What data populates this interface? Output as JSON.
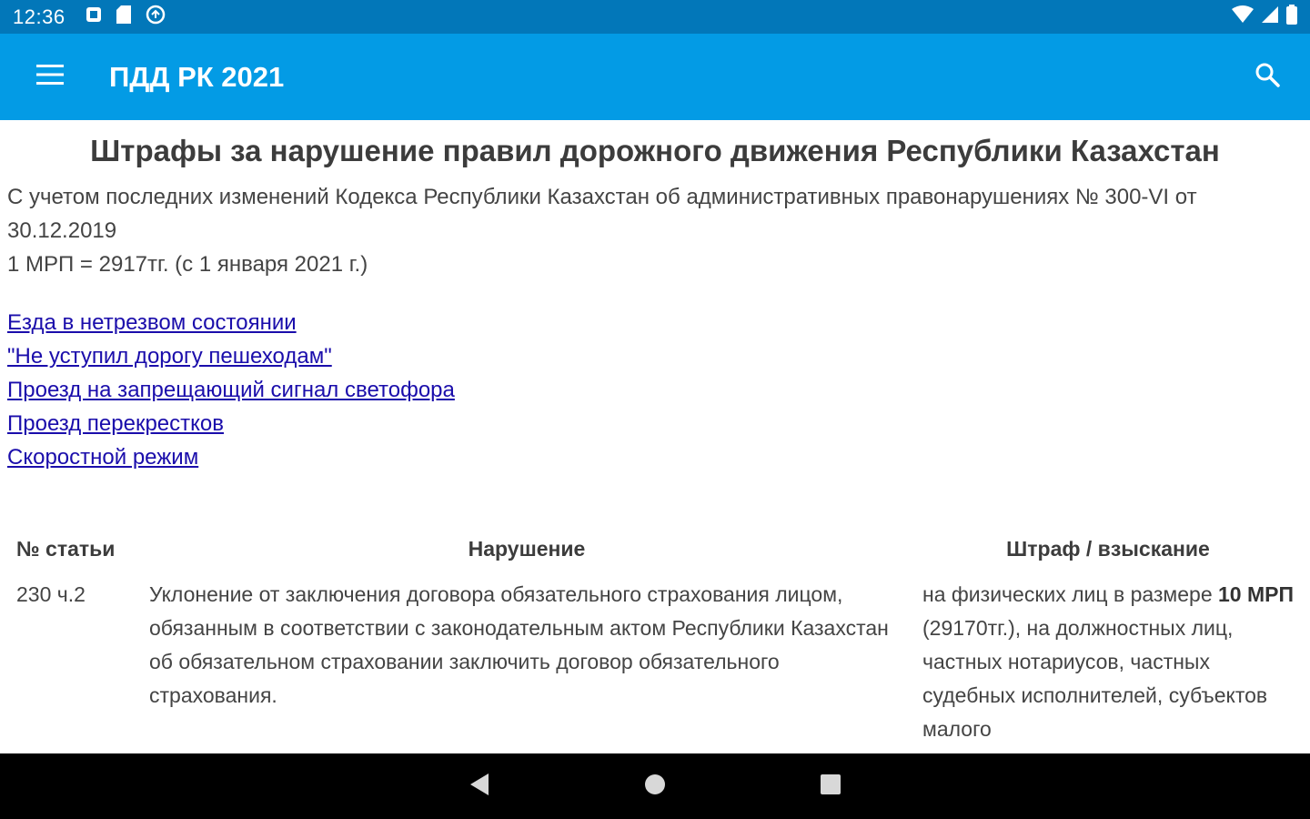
{
  "status_bar": {
    "time": "12:36",
    "left_icons": [
      "notification-icon",
      "sd-card-icon",
      "sync-icon"
    ],
    "right_icons": [
      "wifi-icon",
      "cell-signal-icon",
      "battery-icon"
    ]
  },
  "app_bar": {
    "title": "ПДД РК 2021",
    "menu_icon": "hamburger-menu-icon",
    "search_icon": "search-icon",
    "color": "#039be5"
  },
  "content": {
    "title": "Штрафы за нарушение правил дорожного движения Республики Казахстан",
    "intro_line1": "С учетом последних изменений Кодекса Республики Казахстан об административных правонарушениях № 300-VI от 30.12.2019",
    "intro_line2": "1 МРП = 2917тг. (с 1 января 2021 г.)",
    "links": [
      "Езда в нетрезвом состоянии",
      "\"Не уступил дорогу пешеходам\"",
      "Проезд на запрещающий сигнал светофора",
      "Проезд перекрестков",
      "Скоростной режим"
    ],
    "link_color": "#1a0dab"
  },
  "table": {
    "headers": [
      "№ статьи",
      "Нарушение",
      "Штраф / взыскание"
    ],
    "rows": [
      {
        "article": "230 ч.2",
        "violation": "Уклонение от заключения договора обязательного страхования лицом, обязанным в соответствии с законодательным актом Республики Казахстан об обязательном страховании заключить договор обязательного страхования.",
        "penalty_prefix": "на физических лиц в размере ",
        "penalty_bold": "10 МРП",
        "penalty_suffix": " (29170тг.), на должностных лиц, частных нотариусов, частных судебных исполнителей, субъектов малого"
      }
    ]
  },
  "nav_bar": {
    "buttons": [
      "back-icon",
      "home-icon",
      "recents-icon"
    ]
  }
}
